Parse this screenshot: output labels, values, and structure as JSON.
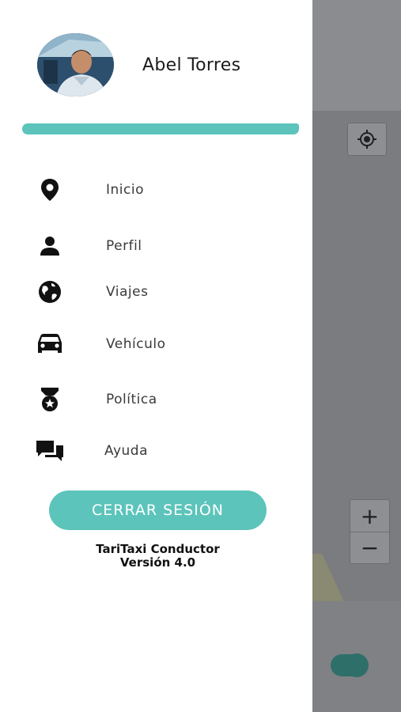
{
  "user": {
    "name": "Abel Torres"
  },
  "menu": {
    "items": [
      {
        "label": "Inicio",
        "icon": "location-pin-icon"
      },
      {
        "label": "Perfil",
        "icon": "person-icon"
      },
      {
        "label": "Viajes",
        "icon": "globe-icon"
      },
      {
        "label": "Vehículo",
        "icon": "car-icon"
      },
      {
        "label": "Política",
        "icon": "medal-icon"
      },
      {
        "label": "Ayuda",
        "icon": "chat-bubbles-icon"
      }
    ]
  },
  "logout": {
    "label": "CERRAR SESIÓN"
  },
  "app": {
    "name": "TariTaxi Conductor",
    "version": "Versión 4.0"
  },
  "map": {
    "zoom_in": "+",
    "zoom_out": "−"
  },
  "colors": {
    "accent": "#5cc4bb",
    "overlay": "#7d7f83"
  }
}
